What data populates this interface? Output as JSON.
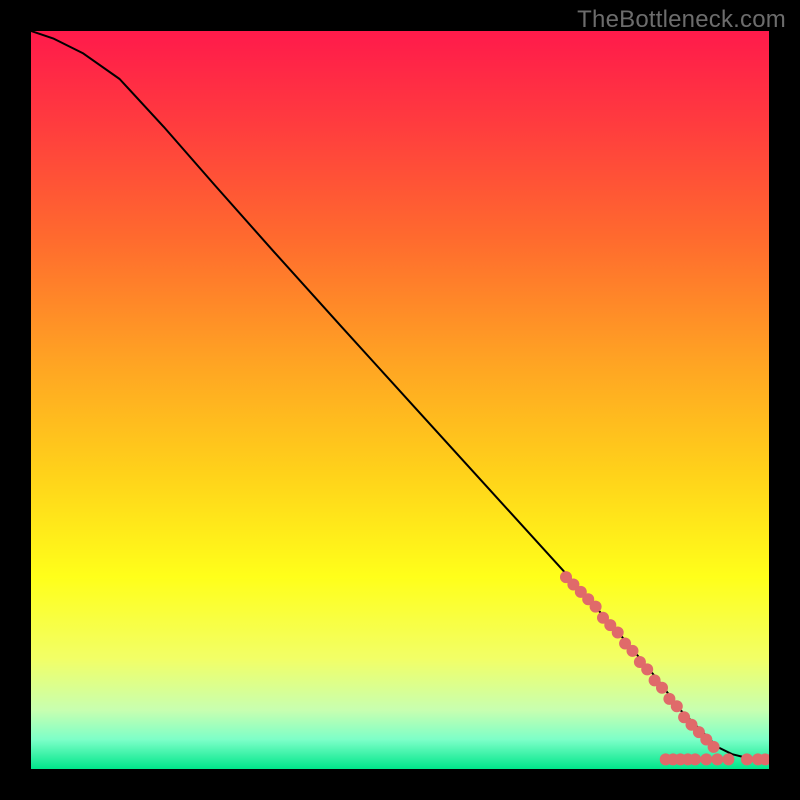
{
  "watermark": "TheBottleneck.com",
  "chart_data": {
    "type": "line",
    "title": "",
    "xlabel": "",
    "ylabel": "",
    "xlim": [
      0,
      100
    ],
    "ylim": [
      0,
      100
    ],
    "gradient_stops": [
      {
        "pct": 0,
        "color": "#ff1a4b"
      },
      {
        "pct": 12,
        "color": "#ff3a3f"
      },
      {
        "pct": 28,
        "color": "#ff6a2e"
      },
      {
        "pct": 45,
        "color": "#ffa423"
      },
      {
        "pct": 60,
        "color": "#ffd21a"
      },
      {
        "pct": 74,
        "color": "#ffff1a"
      },
      {
        "pct": 85,
        "color": "#f2ff66"
      },
      {
        "pct": 92,
        "color": "#c8ffb0"
      },
      {
        "pct": 96,
        "color": "#7dffc8"
      },
      {
        "pct": 100,
        "color": "#00e68a"
      }
    ],
    "series": [
      {
        "name": "curve",
        "stroke": "#000000",
        "stroke_width": 2,
        "x": [
          0,
          3,
          7,
          12,
          18,
          25,
          33,
          42,
          52,
          62,
          72,
          80,
          85,
          88,
          91,
          93,
          95,
          97,
          99,
          100
        ],
        "y": [
          100,
          99,
          97,
          93.5,
          87,
          79,
          70,
          60,
          49,
          38,
          27,
          18,
          12,
          8,
          5,
          3,
          2,
          1.5,
          1.3,
          1.3
        ]
      }
    ],
    "scatter": {
      "name": "highlighted-points",
      "color": "#e06a6a",
      "radius": 6,
      "points": [
        {
          "x": 72.5,
          "y": 26
        },
        {
          "x": 73.5,
          "y": 25
        },
        {
          "x": 74.5,
          "y": 24
        },
        {
          "x": 75.5,
          "y": 23
        },
        {
          "x": 76.5,
          "y": 22
        },
        {
          "x": 77.5,
          "y": 20.5
        },
        {
          "x": 78.5,
          "y": 19.5
        },
        {
          "x": 79.5,
          "y": 18.5
        },
        {
          "x": 80.5,
          "y": 17
        },
        {
          "x": 81.5,
          "y": 16
        },
        {
          "x": 82.5,
          "y": 14.5
        },
        {
          "x": 83.5,
          "y": 13.5
        },
        {
          "x": 84.5,
          "y": 12
        },
        {
          "x": 85.5,
          "y": 11
        },
        {
          "x": 86.5,
          "y": 9.5
        },
        {
          "x": 87.5,
          "y": 8.5
        },
        {
          "x": 88.5,
          "y": 7
        },
        {
          "x": 89.5,
          "y": 6
        },
        {
          "x": 90.5,
          "y": 5
        },
        {
          "x": 91.5,
          "y": 4
        },
        {
          "x": 92.5,
          "y": 3
        },
        {
          "x": 86,
          "y": 1.3
        },
        {
          "x": 87,
          "y": 1.3
        },
        {
          "x": 88,
          "y": 1.3
        },
        {
          "x": 89,
          "y": 1.3
        },
        {
          "x": 90,
          "y": 1.3
        },
        {
          "x": 91.5,
          "y": 1.3
        },
        {
          "x": 93,
          "y": 1.3
        },
        {
          "x": 94.5,
          "y": 1.3
        },
        {
          "x": 97,
          "y": 1.3
        },
        {
          "x": 98.5,
          "y": 1.3
        },
        {
          "x": 99.5,
          "y": 1.3
        }
      ]
    }
  }
}
